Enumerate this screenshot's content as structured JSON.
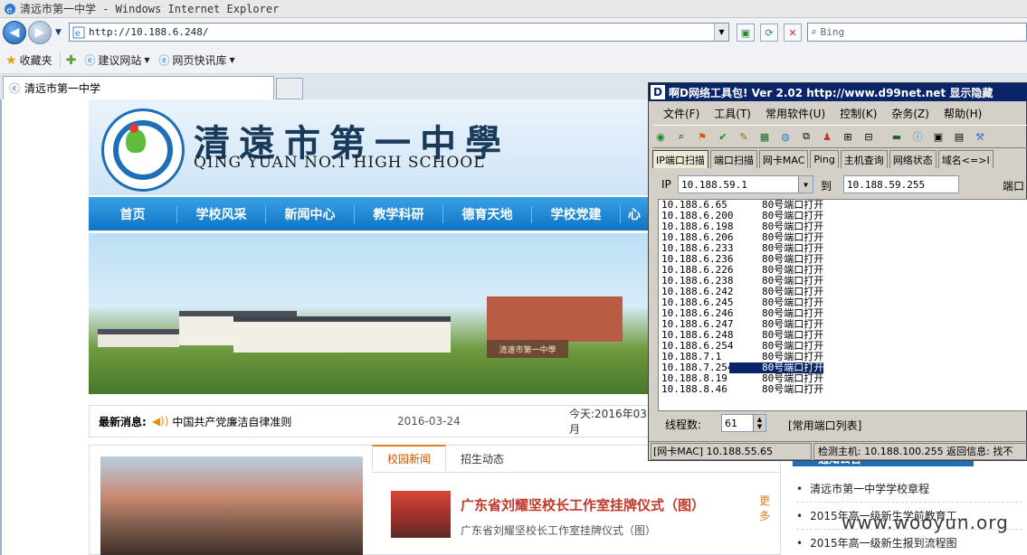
{
  "browser": {
    "window_title": "清远市第一中学 - Windows Internet Explorer",
    "url": "http://10.188.6.248/",
    "search_placeholder": "Bing",
    "favorites_label": "收藏夹",
    "fav_suggested_sites": "建议网站",
    "fav_web_slices": "网页快讯库",
    "tab_title": "清远市第一中学"
  },
  "site": {
    "name_cn": "清遠市第一中學",
    "name_en": "QING YUAN NO.1 HIGH SCHOOL",
    "nav": [
      "首页",
      "学校风采",
      "新闻中心",
      "教学科研",
      "德育天地",
      "学校党建",
      "心"
    ],
    "gate_sign": "清遠市第一中學",
    "news_label": "最新消息:",
    "news_text": "中国共产党廉洁自律准则",
    "news_date": "2016-03-24",
    "today": "今天:2016年03月",
    "tabs": [
      "校园新闻",
      "招生动态"
    ],
    "headline": "广东省刘耀坚校长工作室挂牌仪式（图）",
    "subline": "广东省刘耀坚校长工作室挂牌仪式（图）",
    "more": "更多",
    "notice_title": "通知公告",
    "notices": [
      "清远市第一中学学校章程",
      "2015年高一级新生学前教育工…",
      "2015年高一级新生报到流程图"
    ],
    "watermark": "www.wooyun.org"
  },
  "tool": {
    "title": "啊D网络工具包!  Ver 2.02   http://www.d99net.net  显示隐藏",
    "menu": [
      "文件(F)",
      "工具(T)",
      "常用软件(U)",
      "控制(K)",
      "杂务(Z)",
      "帮助(H)"
    ],
    "tabs": [
      "IP端口扫描",
      "端口扫描",
      "网卡MAC",
      "Ping",
      "主机查询",
      "网络状态",
      "域名<=>I"
    ],
    "ip_label": "IP",
    "ip_from": "10.188.59.1",
    "to_label": "到",
    "ip_to": "10.188.59.255",
    "port_label": "端口",
    "results": [
      {
        "ip": "10.188.6.65",
        "status": "80号端口打开"
      },
      {
        "ip": "10.188.6.200",
        "status": "80号端口打开"
      },
      {
        "ip": "10.188.6.198",
        "status": "80号端口打开"
      },
      {
        "ip": "10.188.6.206",
        "status": "80号端口打开"
      },
      {
        "ip": "10.188.6.233",
        "status": "80号端口打开"
      },
      {
        "ip": "10.188.6.236",
        "status": "80号端口打开"
      },
      {
        "ip": "10.188.6.226",
        "status": "80号端口打开"
      },
      {
        "ip": "10.188.6.238",
        "status": "80号端口打开"
      },
      {
        "ip": "10.188.6.242",
        "status": "80号端口打开"
      },
      {
        "ip": "10.188.6.245",
        "status": "80号端口打开"
      },
      {
        "ip": "10.188.6.246",
        "status": "80号端口打开"
      },
      {
        "ip": "10.188.6.247",
        "status": "80号端口打开"
      },
      {
        "ip": "10.188.6.248",
        "status": "80号端口打开"
      },
      {
        "ip": "10.188.6.254",
        "status": "80号端口打开"
      },
      {
        "ip": "10.188.7.1",
        "status": "80号端口打开"
      },
      {
        "ip": "10.188.7.254",
        "status": "80号端口打开",
        "selected": true
      },
      {
        "ip": "10.188.8.19",
        "status": "80号端口打开"
      },
      {
        "ip": "10.188.8.46",
        "status": "80号端口打开"
      }
    ],
    "thread_label": "线程数:",
    "thread_value": "61",
    "common_ports": "[常用端口列表]",
    "status_mac": "[网卡MAC] 10.188.55.65",
    "status_host": "检测主机: 10.188.100.255  返回信息: 找不"
  }
}
